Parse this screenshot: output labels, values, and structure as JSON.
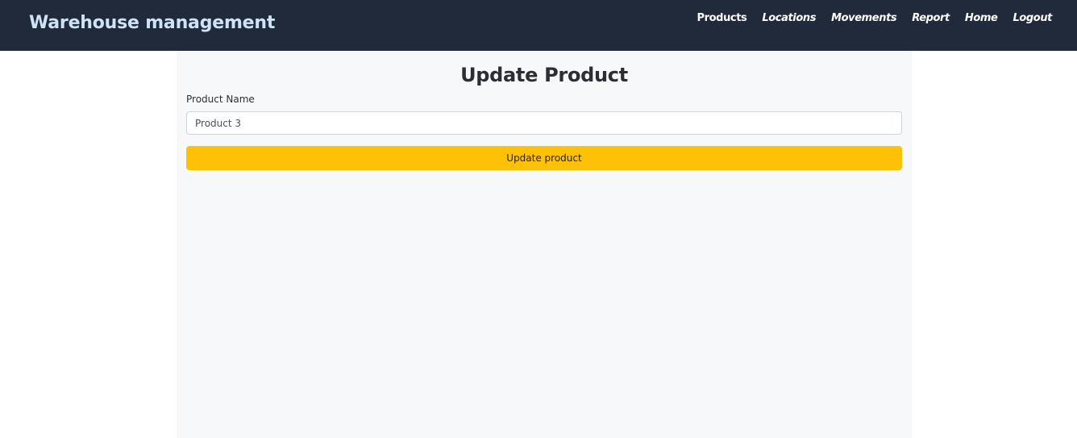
{
  "navbar": {
    "brand": "Warehouse management",
    "links": [
      {
        "label": "Products"
      },
      {
        "label": "Locations"
      },
      {
        "label": "Movements"
      },
      {
        "label": "Report"
      },
      {
        "label": "Home"
      },
      {
        "label": "Logout"
      }
    ]
  },
  "form": {
    "title": "Update Product",
    "product_name_label": "Product Name",
    "product_name_value": "Product 3",
    "submit_label": "Update product"
  },
  "colors": {
    "navbar_bg": "#212a3a",
    "brand_text": "#cfe3f7",
    "button_bg": "#ffc107",
    "panel_bg": "#f7f8fa"
  }
}
